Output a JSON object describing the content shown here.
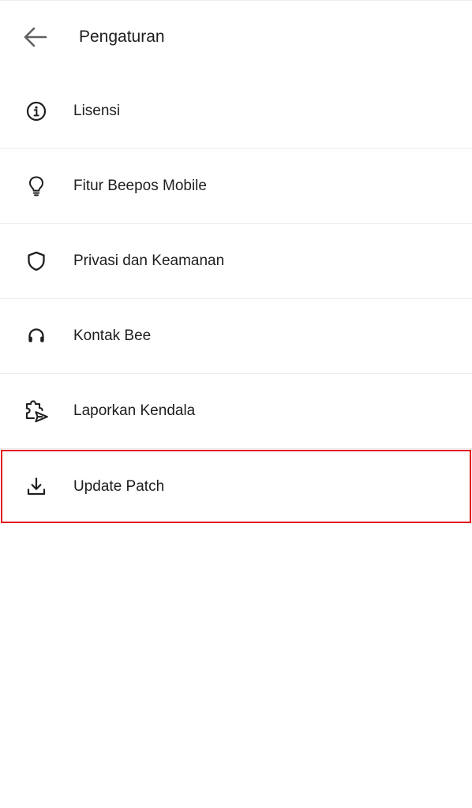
{
  "header": {
    "title": "Pengaturan",
    "back_icon": "arrow-left-icon"
  },
  "menu": {
    "items": [
      {
        "label": "Lisensi",
        "icon": "info-circle-icon"
      },
      {
        "label": "Fitur Beepos Mobile",
        "icon": "lightbulb-icon"
      },
      {
        "label": "Privasi dan Keamanan",
        "icon": "shield-icon"
      },
      {
        "label": "Kontak Bee",
        "icon": "headset-icon"
      },
      {
        "label": "Laporkan Kendala",
        "icon": "puzzle-send-icon"
      },
      {
        "label": "Update Patch",
        "icon": "download-icon"
      }
    ]
  },
  "colors": {
    "highlight_border": "#e2141b",
    "text": "#1e1e1e",
    "divider": "#ececec"
  }
}
